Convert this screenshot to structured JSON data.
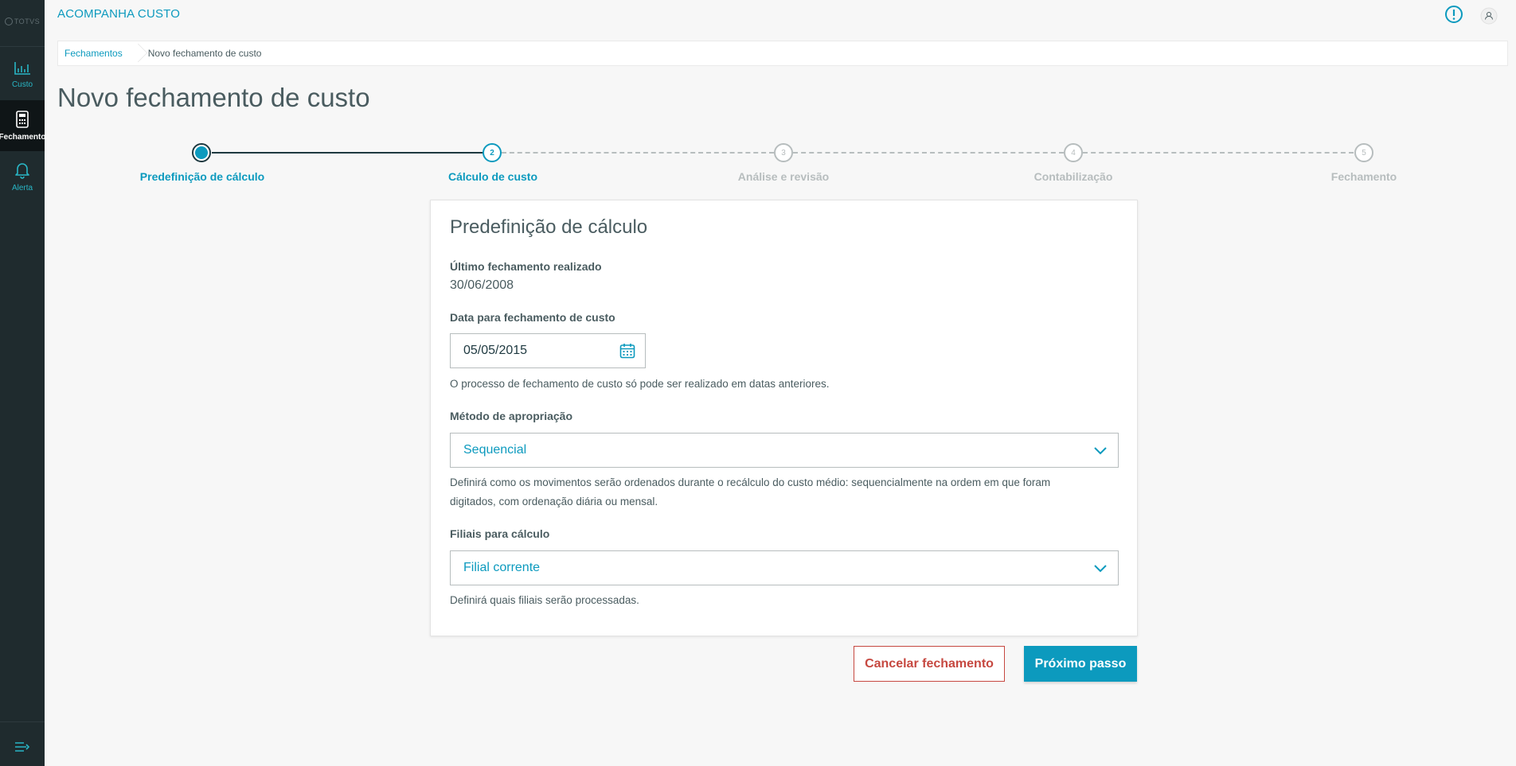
{
  "brand": {
    "name": "TOTVS"
  },
  "sidebar": {
    "items": [
      {
        "label": "Custo",
        "icon": "bar-chart-icon"
      },
      {
        "label": "Fechamento",
        "icon": "calculator-icon"
      },
      {
        "label": "Alerta",
        "icon": "bell-icon"
      }
    ]
  },
  "header": {
    "app_title": "ACOMPANHA CUSTO"
  },
  "breadcrumb": {
    "items": [
      "Fechamentos",
      "Novo fechamento de custo"
    ]
  },
  "page": {
    "title": "Novo fechamento de custo"
  },
  "stepper": {
    "steps": [
      {
        "number": "1",
        "label": "Predefinição de cálculo",
        "state": "done"
      },
      {
        "number": "2",
        "label": "Cálculo de custo",
        "state": "current"
      },
      {
        "number": "3",
        "label": "Análise e revisão",
        "state": "pending"
      },
      {
        "number": "4",
        "label": "Contabilização",
        "state": "pending"
      },
      {
        "number": "5",
        "label": "Fechamento",
        "state": "pending"
      }
    ]
  },
  "card": {
    "title": "Predefinição de cálculo",
    "last_closing": {
      "label": "Último fechamento realizado",
      "value": "30/06/2008"
    },
    "closing_date": {
      "label": "Data para fechamento de custo",
      "value": "05/05/2015",
      "help": "O processo de fechamento de custo só pode ser realizado em datas anteriores."
    },
    "method": {
      "label": "Método de apropriação",
      "value": "Sequencial",
      "help": "Definirá como os movimentos serão ordenados durante o recálculo do custo médio: sequencialmente na ordem em que foram digitados, com ordenação diária ou mensal."
    },
    "branches": {
      "label": "Filiais para cálculo",
      "value": "Filial corrente",
      "help": "Definirá quais filiais serão processadas."
    }
  },
  "actions": {
    "cancel_label": "Cancelar fechamento",
    "next_label": "Próximo passo"
  },
  "colors": {
    "primary": "#0c9abe",
    "sidebar_bg": "#1f2b2e",
    "danger": "#c64840",
    "text": "#4a5c60"
  }
}
